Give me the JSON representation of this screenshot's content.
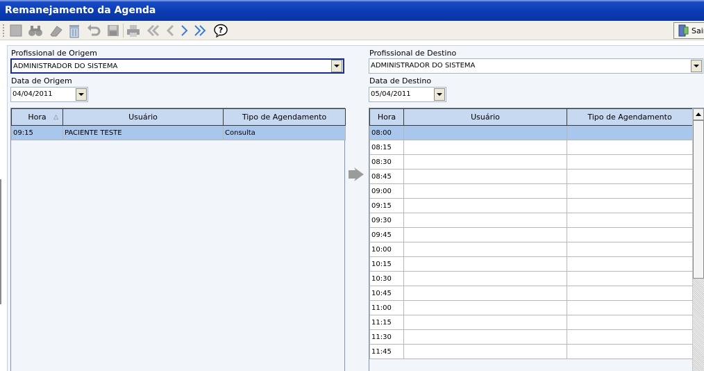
{
  "window": {
    "title": "Remanejamento da Agenda"
  },
  "toolbar": {
    "buttons": [
      {
        "name": "new-icon"
      },
      {
        "name": "binoculars-icon"
      },
      {
        "name": "eraser-icon"
      },
      {
        "name": "trash-icon"
      },
      {
        "name": "undo-icon"
      },
      {
        "name": "save-icon"
      },
      {
        "name": "print-icon"
      },
      {
        "name": "first-icon"
      },
      {
        "name": "previous-icon"
      },
      {
        "name": "next-icon"
      },
      {
        "name": "last-icon"
      },
      {
        "name": "help-icon"
      }
    ],
    "exit_label": "Sair"
  },
  "origin": {
    "professional_label": "Profissional de Origem",
    "professional_value": "ADMINISTRADOR DO SISTEMA",
    "date_label": "Data de Origem",
    "date_value": "04/04/2011",
    "columns": [
      "Hora",
      "Usuário",
      "Tipo de Agendamento"
    ],
    "rows": [
      {
        "hora": "09:15",
        "usuario": "PACIENTE TESTE",
        "tipo": "Consulta"
      }
    ]
  },
  "destination": {
    "professional_label": "Profissional de Destino",
    "professional_value": "ADMINISTRADOR DO SISTEMA",
    "date_label": "Data de Destino",
    "date_value": "05/04/2011",
    "columns": [
      "Hora",
      "Usuário",
      "Tipo de Agendamento"
    ],
    "rows": [
      {
        "hora": "08:00",
        "usuario": "",
        "tipo": ""
      },
      {
        "hora": "08:15",
        "usuario": "",
        "tipo": ""
      },
      {
        "hora": "08:30",
        "usuario": "",
        "tipo": ""
      },
      {
        "hora": "08:45",
        "usuario": "",
        "tipo": ""
      },
      {
        "hora": "09:00",
        "usuario": "",
        "tipo": ""
      },
      {
        "hora": "09:15",
        "usuario": "",
        "tipo": ""
      },
      {
        "hora": "09:30",
        "usuario": "",
        "tipo": ""
      },
      {
        "hora": "09:45",
        "usuario": "",
        "tipo": ""
      },
      {
        "hora": "10:00",
        "usuario": "",
        "tipo": ""
      },
      {
        "hora": "10:15",
        "usuario": "",
        "tipo": ""
      },
      {
        "hora": "10:30",
        "usuario": "",
        "tipo": ""
      },
      {
        "hora": "10:45",
        "usuario": "",
        "tipo": ""
      },
      {
        "hora": "11:00",
        "usuario": "",
        "tipo": ""
      },
      {
        "hora": "11:15",
        "usuario": "",
        "tipo": ""
      },
      {
        "hora": "11:30",
        "usuario": "",
        "tipo": ""
      },
      {
        "hora": "11:45",
        "usuario": "",
        "tipo": ""
      }
    ]
  }
}
